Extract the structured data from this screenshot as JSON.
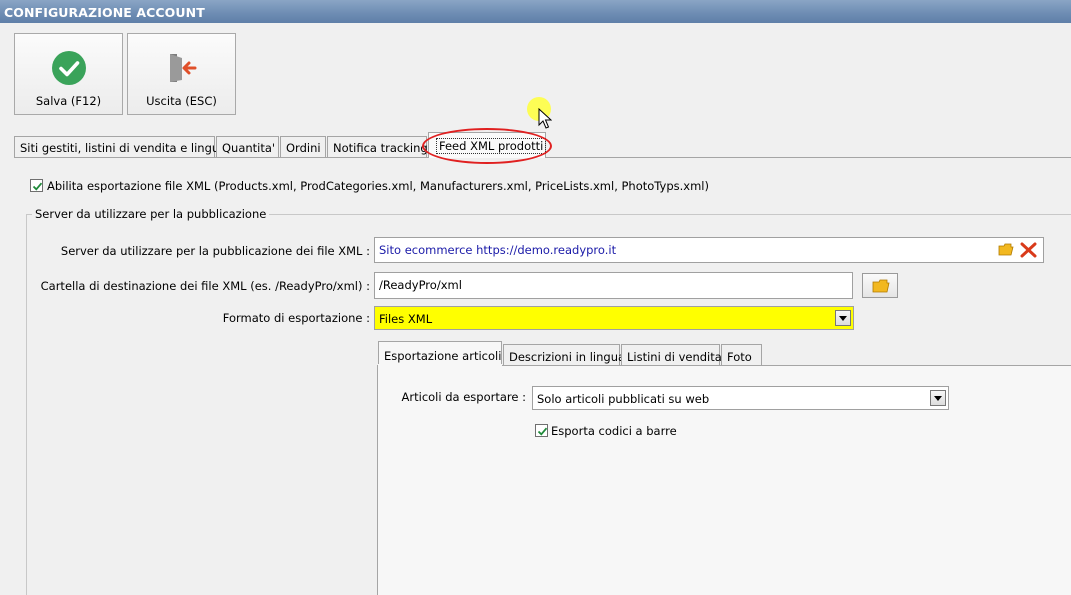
{
  "window": {
    "title": "CONFIGURAZIONE ACCOUNT"
  },
  "toolbar": {
    "save_label": "Salva (F12)",
    "exit_label": "Uscita (ESC)"
  },
  "tabs": [
    {
      "label": "Siti gestiti, listini di vendita e lingue"
    },
    {
      "label": "Quantita'"
    },
    {
      "label": "Ordini"
    },
    {
      "label": "Notifica tracking"
    },
    {
      "label": "Feed XML prodotti"
    }
  ],
  "feed": {
    "enable_export_label": "Abilita esportazione file XML (Products.xml, ProdCategories.xml, Manufacturers.xml, PriceLists.xml, PhotoTyps.xml)",
    "enable_export_checked": true,
    "group_title": "Server da utilizzare per la pubblicazione",
    "server_label": "Server da utilizzare per la pubblicazione  dei file XML :",
    "server_value": "Sito ecommerce https://demo.readypro.it",
    "folder_label": "Cartella di destinazione dei file XML (es. /ReadyPro/xml) :",
    "folder_value": "/ReadyPro/xml",
    "format_label": "Formato di esportazione :",
    "format_value": "Files XML"
  },
  "inner_tabs": [
    {
      "label": "Esportazione articoli"
    },
    {
      "label": "Descrizioni in lingua"
    },
    {
      "label": "Listini di vendita"
    },
    {
      "label": "Foto"
    }
  ],
  "articles": {
    "export_label": "Articoli da esportare :",
    "export_value": "Solo articoli pubblicati su web",
    "barcode_label": "Esporta codici a barre",
    "barcode_checked": true
  },
  "colors": {
    "title_bar": "#6d8cb3",
    "accent_green": "#3aa35a",
    "highlight_yellow": "#ffff00",
    "annotation_red": "#e02020",
    "server_text": "#1a1aa8"
  }
}
